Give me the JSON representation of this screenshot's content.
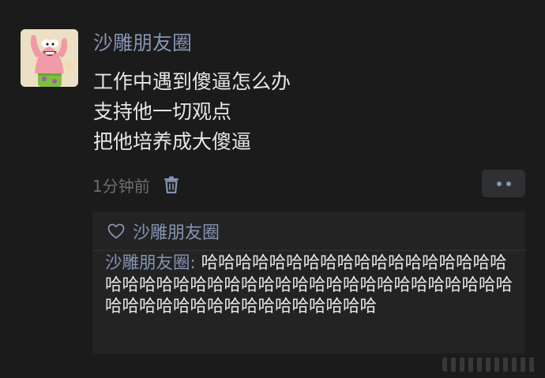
{
  "post": {
    "username": "沙雕朋友圈",
    "lines": [
      "工作中遇到傻逼怎么办",
      "支持他一切观点",
      "把他培养成大傻逼"
    ],
    "timestamp": "1分钟前"
  },
  "interactions": {
    "likes": "沙雕朋友圈",
    "comment": {
      "author": "沙雕朋友圈",
      "separator": ": ",
      "text": "哈哈哈哈哈哈哈哈哈哈哈哈哈哈哈哈哈哈哈哈哈哈哈哈哈哈哈哈哈哈哈哈哈哈哈哈哈哈哈哈哈哈哈哈哈哈哈哈哈哈哈哈哈哈哈哈哈哈"
    }
  },
  "icons": {
    "delete": "trash-icon",
    "more": "more-dots-icon",
    "like": "heart-outline-icon"
  },
  "colors": {
    "background": "#1b1b1b",
    "name_link": "#8594b2",
    "text": "#e6e6e6",
    "muted": "#6d6d6d",
    "panel": "#232323"
  }
}
